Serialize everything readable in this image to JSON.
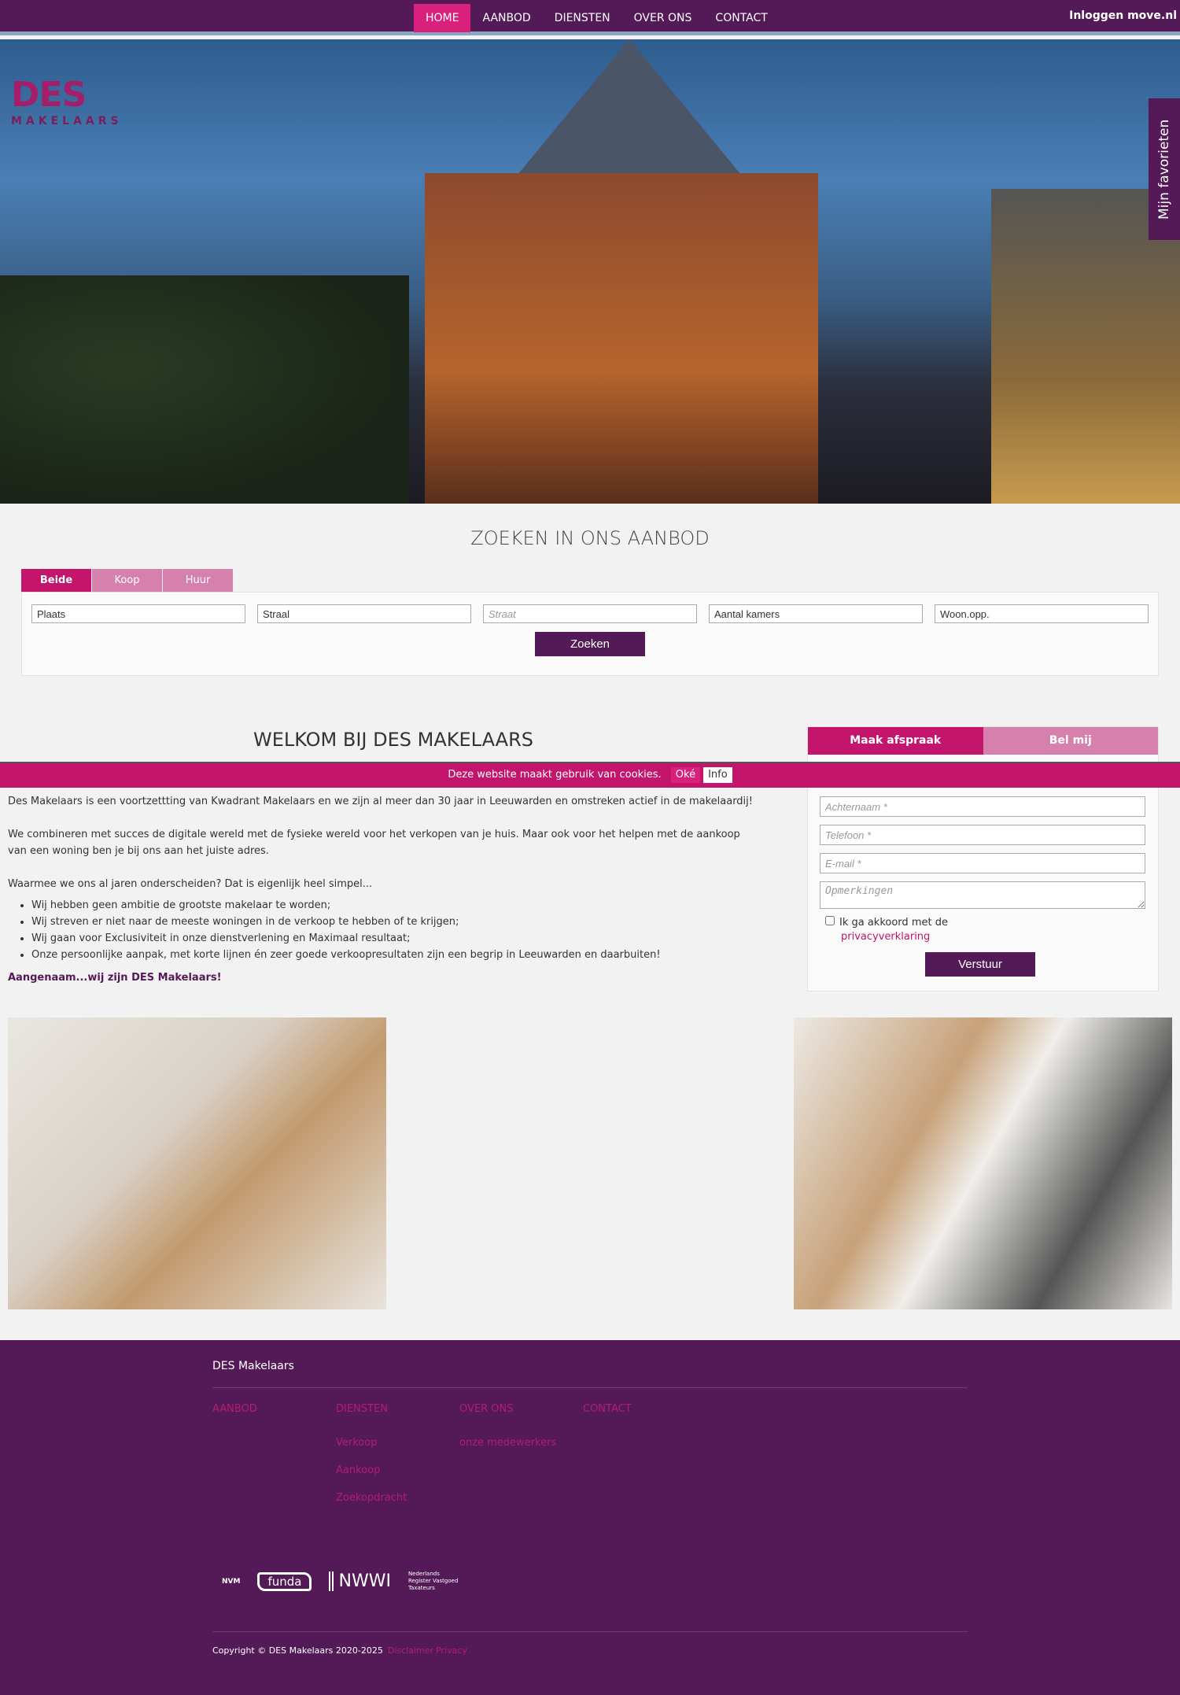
{
  "nav": {
    "items": [
      {
        "label": "HOME",
        "active": true
      },
      {
        "label": "AANBOD"
      },
      {
        "label": "DIENSTEN"
      },
      {
        "label": "OVER ONS"
      },
      {
        "label": "CONTACT"
      }
    ],
    "login": "Inloggen move.nl"
  },
  "logo": {
    "name": "DES",
    "sub": "MAKELAARS"
  },
  "favorites": "Mijn favorieten",
  "search": {
    "title": "ZOEKEN IN ONS AANBOD",
    "tabs": [
      "Beide",
      "Koop",
      "Huur"
    ],
    "fields": [
      {
        "value": "Plaats"
      },
      {
        "value": "Straal"
      },
      {
        "placeholder": "Straat"
      },
      {
        "value": "Aantal kamers"
      },
      {
        "value": "Woon.opp."
      }
    ],
    "button": "Zoeken"
  },
  "welcome": {
    "title": "WELKOM BIJ DES MAKELAARS",
    "p1": "Des Makelaars is een voortzettting van Kwadrant Makelaars en we zijn al meer dan 30 jaar in Leeuwarden en omstreken actief in de makelaardij!",
    "p2a": "We combineren met succes de digitale wereld met de fysieke wereld voor het verkopen van je huis. Maar ook voor het helpen met de aankoop",
    "p2b": "van een woning ben je bij ons aan het juiste adres.",
    "p3": "Waarmee we ons al jaren onderscheiden? Dat is eigenlijk heel simpel...",
    "bullets": [
      "Wij hebben geen ambitie de grootste makelaar te worden;",
      "Wij streven er niet naar de meeste woningen in de verkoop te hebben of te krijgen;",
      "Wij gaan voor Exclusiviteit in onze dienstverlening en Maximaal resultaat;",
      "Onze persoonlijke aanpak, met korte lijnen én zeer goede verkoopresultaten zijn een begrip in Leeuwarden en daarbuiten!"
    ],
    "closing": "Aangenaam...wij zijn DES Makelaars!"
  },
  "form": {
    "tabs": [
      "Maak afspraak",
      "Bel mij"
    ],
    "placeholders": [
      "Achternaam *",
      "Telefoon *",
      "E-mail *",
      "Opmerkingen"
    ],
    "agree": "Ik ga akkoord met de",
    "privacy": "privacyverklaring",
    "button": "Verstuur"
  },
  "cookie": {
    "text": "Deze website maakt gebruik van cookies.",
    "ok": "Oké",
    "info": "Info"
  },
  "footer": {
    "title": "DES Makelaars",
    "cols": [
      {
        "head": "AANBOD",
        "links": []
      },
      {
        "head": "DIENSTEN",
        "links": [
          "Verkoop",
          "Aankoop",
          "Zoekopdracht"
        ]
      },
      {
        "head": "OVER ONS",
        "links": [
          "onze medewerkers"
        ]
      },
      {
        "head": "CONTACT",
        "links": []
      }
    ],
    "logos": [
      "NVM",
      "funda",
      "NWWI",
      "Nederlands Register Vastgoed Taxateurs"
    ],
    "copyright": "Copyright © DES Makelaars 2020-2025",
    "disclaimer": "Disclaimer",
    "privacy": "Privacy"
  },
  "colors": {
    "primary": "#541a58",
    "accent": "#c2156b",
    "accent_light": "#d680ae"
  }
}
